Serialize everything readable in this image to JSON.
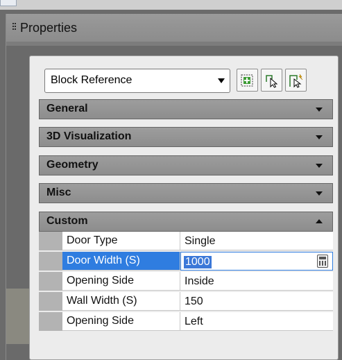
{
  "palette": {
    "title": "Properties"
  },
  "selector": {
    "value": "Block Reference"
  },
  "sections": [
    {
      "label": "General",
      "expanded": false
    },
    {
      "label": "3D Visualization",
      "expanded": false
    },
    {
      "label": "Geometry",
      "expanded": false
    },
    {
      "label": "Misc",
      "expanded": false
    },
    {
      "label": "Custom",
      "expanded": true
    }
  ],
  "custom_rows": [
    {
      "property": "Door Type",
      "value": "Single",
      "selected": false
    },
    {
      "property": "Door Width (S)",
      "value": "1000",
      "selected": true
    },
    {
      "property": "Opening Side",
      "value": "Inside",
      "selected": false
    },
    {
      "property": "Wall Width (S)",
      "value": "150",
      "selected": false
    },
    {
      "property": "Opening Side",
      "value": "Left",
      "selected": false
    }
  ],
  "icons": {
    "quick_select": "quick-select-icon",
    "select_objects": "select-objects-icon",
    "toggle_pickadd": "toggle-pickadd-icon",
    "calculator": "calculator-icon"
  },
  "colors": {
    "selection": "#2f7de0",
    "section_bar": "#9d9d9d"
  }
}
